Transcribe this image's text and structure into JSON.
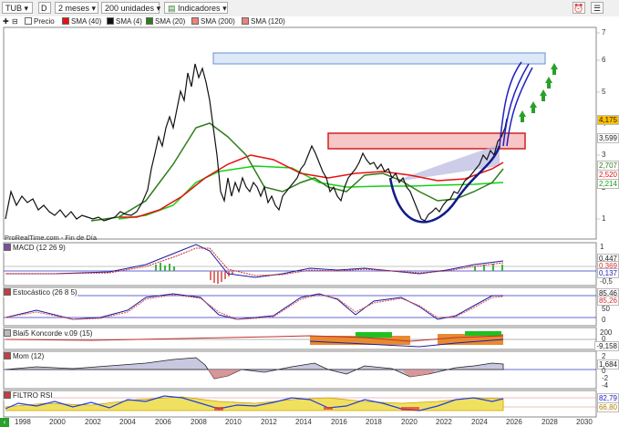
{
  "toolbar": {
    "ticker": "TUB",
    "period_letter": "D",
    "range": "2 meses",
    "units": "200 unidades",
    "indicators": "Indicadores"
  },
  "legend": {
    "items": [
      "Precio",
      "SMA (40)",
      "SMA (4)",
      "SMA (20)",
      "SMA (200)",
      "SMA (120)"
    ],
    "colors": [
      "#ffffff",
      "#e81010",
      "#111111",
      "#2e7d1a",
      "#f08080",
      "#f08080"
    ]
  },
  "price_axis": {
    "ticks": [
      "7",
      "6",
      "5",
      "4",
      "3",
      "2",
      "1"
    ]
  },
  "price_tags": [
    "4,175",
    "3,599",
    "2,707",
    "2,520",
    "2,214"
  ],
  "source": "ProRealTime.com - Fin de Día",
  "panels": {
    "macd": {
      "label": "MACD (12 26 9)",
      "ticks": [
        "1",
        "0,447",
        "0,369",
        "0,137",
        "-0,5"
      ]
    },
    "stoch": {
      "label": "Estocástico (26 8 5)",
      "ticks": [
        "85,46",
        "85,26",
        "50",
        "0"
      ]
    },
    "koncorde": {
      "label": "Blai5 Koncorde v.09 (15)",
      "ticks": [
        "200",
        "0",
        "-9,158"
      ]
    },
    "mom": {
      "label": "Mom (12)",
      "ticks": [
        "2",
        "1,684",
        "0",
        "-2",
        "-4"
      ]
    },
    "rsi": {
      "label": "FILTRO RSI",
      "ticks": [
        "82,79",
        "66,80"
      ]
    }
  },
  "xaxis": [
    "1998",
    "2000",
    "2002",
    "2004",
    "2006",
    "2008",
    "2010",
    "2012",
    "2014",
    "2016",
    "2018",
    "2020",
    "2022",
    "2024",
    "2026",
    "2028",
    "2030"
  ],
  "colors": {
    "up_arrow": "#2aa02a",
    "zone_red": "#f7c6c6",
    "zone_blue": "#dde8f8",
    "wedge": "#b8b8e0"
  }
}
